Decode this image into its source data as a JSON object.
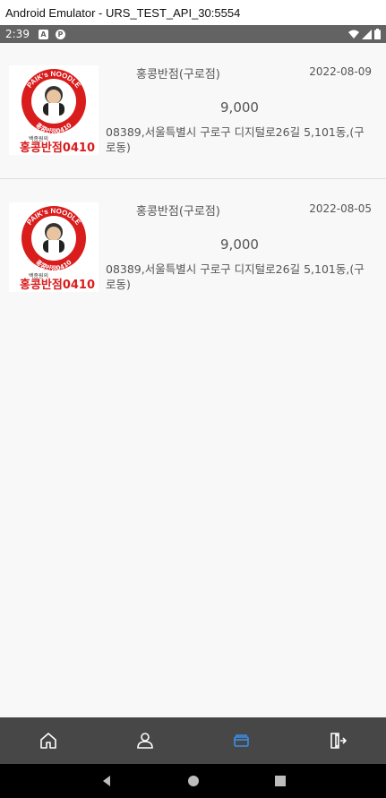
{
  "window": {
    "title": "Android Emulator - URS_TEST_API_30:5554"
  },
  "status_bar": {
    "time": "2:39",
    "notif_a": "A",
    "notif_p": "P"
  },
  "orders": [
    {
      "logo": {
        "top_text": "PAIK's NOODLE",
        "ring_text": "홍콩반점0410",
        "brand": "홍콩반점0410",
        "small": "백종원의"
      },
      "shop": "홍콩반점(구로점)",
      "date": "2022-08-09",
      "price": "9,000",
      "address": "08389,서울특별시 구로구 디지털로26길 5,101동,(구로동)"
    },
    {
      "logo": {
        "top_text": "PAIK's NOODLE",
        "ring_text": "홍콩반점0410",
        "brand": "홍콩반점0410",
        "small": "백종원의"
      },
      "shop": "홍콩반점(구로점)",
      "date": "2022-08-05",
      "price": "9,000",
      "address": "08389,서울특별시 구로구 디지털로26길 5,101동,(구로동)"
    }
  ],
  "bottom_nav": {
    "tabs": [
      {
        "icon": "home-icon"
      },
      {
        "icon": "person-icon"
      },
      {
        "icon": "card-icon",
        "active": true
      },
      {
        "icon": "exit-icon"
      }
    ],
    "active_color": "#3d8fe8",
    "inactive_color": "#ffffff"
  }
}
